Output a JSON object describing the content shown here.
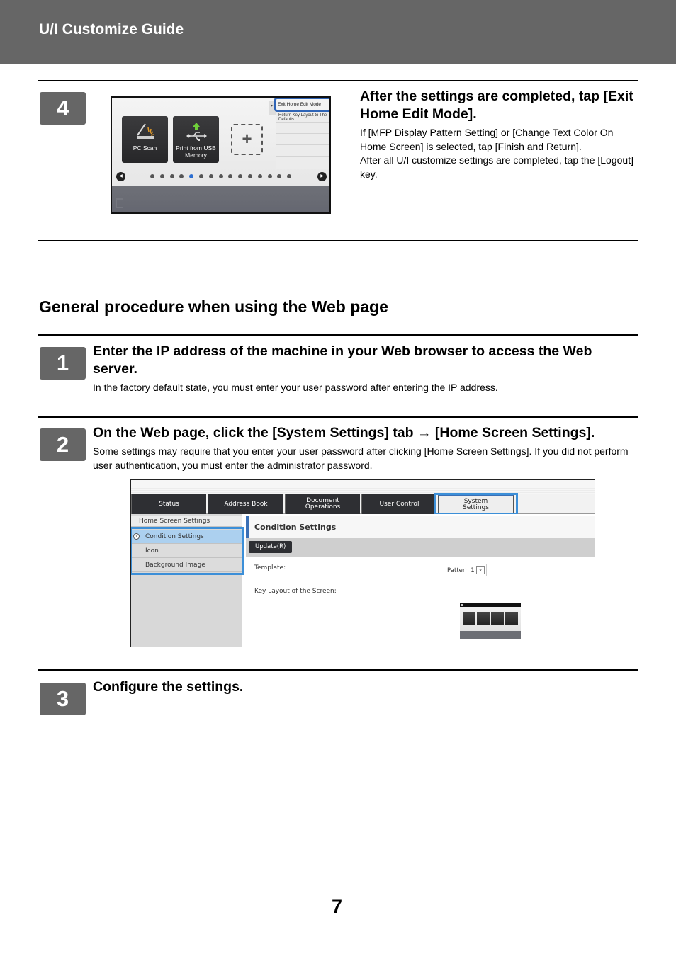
{
  "header": {
    "title": "U/I Customize Guide"
  },
  "step4": {
    "number": "4",
    "title": "After the settings are completed,  tap [Exit Home Edit Mode].",
    "body_lines": [
      "If [MFP Display Pattern Setting] or [Change Text Color On Home Screen] is selected, tap [Finish and Return].",
      "After all U/I customize settings are completed, tap the [Logout] key."
    ],
    "screen": {
      "tiles": [
        {
          "label": "PC Scan",
          "icon": "scanner-icon"
        },
        {
          "label": "Print from USB Memory",
          "icon": "usb-print-icon"
        }
      ],
      "add_tile_icon": "plus-icon",
      "menu": {
        "highlighted_item": "Exit Home Edit Mode",
        "items": [
          "Return Key Layout to The Defaults"
        ]
      },
      "pager": {
        "total_pages": 15,
        "current_page": 5
      }
    }
  },
  "section": {
    "title": "General procedure when using the Web page"
  },
  "step1": {
    "number": "1",
    "title": "Enter the IP address of the machine in your Web browser to access the Web server.",
    "body": "In the factory default state, you must enter your user password after entering the IP address."
  },
  "step2": {
    "number": "2",
    "title": "On the Web page, click the [System Settings] tab → [Home Screen Settings].",
    "body": "Some settings may require that you enter your user password after clicking [Home Screen Settings]. If you did not perform user authentication, you must enter the administrator password.",
    "web": {
      "tabs": [
        "Status",
        "Address Book",
        "Document Operations",
        "User Control",
        "System Settings"
      ],
      "selected_tab": "System Settings",
      "sidebar_header": "Home Screen Settings",
      "sidebar_items": [
        "Condition Settings",
        "Icon",
        "Background Image"
      ],
      "selected_sidebar_item": "Condition Settings",
      "main_title": "Condition Settings",
      "update_button": "Update(R)",
      "template_label": "Template:",
      "template_value": "Pattern 1",
      "key_layout_label": "Key Layout of the Screen:"
    }
  },
  "step3": {
    "number": "3",
    "title": "Configure the settings."
  },
  "footer": {
    "page_number": "7"
  },
  "colors": {
    "header_bg": "#666666",
    "highlight": "#3c8fd8",
    "selected_row": "#acd0ef"
  }
}
